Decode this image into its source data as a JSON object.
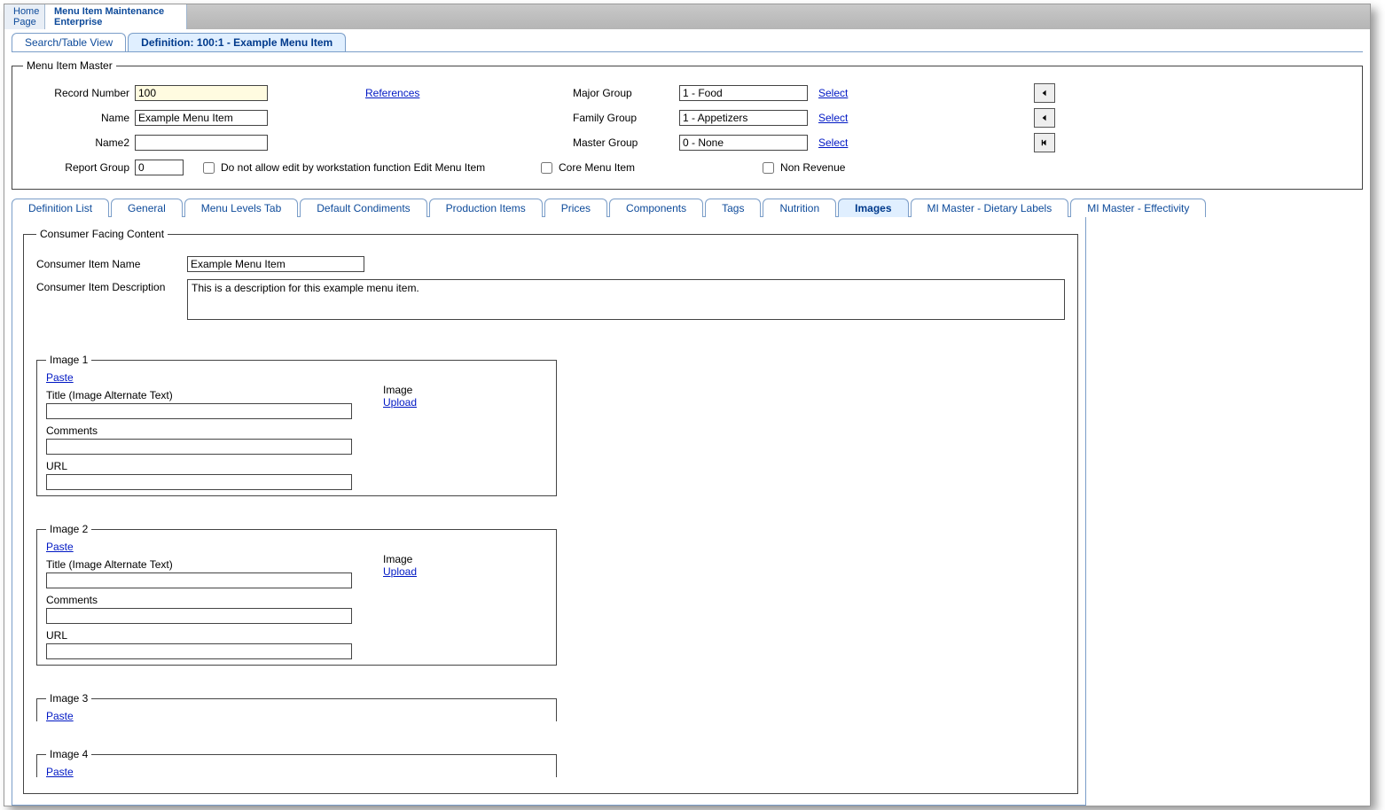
{
  "topTabs": {
    "home": "Home\nPage",
    "active": "Menu Item Maintenance\nEnterprise"
  },
  "viewTabs": {
    "search": "Search/Table View",
    "def": "Definition: 100:1 - Example Menu Item"
  },
  "master": {
    "legend": "Menu Item Master",
    "recordNumberLabel": "Record Number",
    "recordNumber": "100",
    "nameLabel": "Name",
    "name": "Example Menu Item",
    "name2Label": "Name2",
    "name2": "",
    "reportGroupLabel": "Report Group",
    "reportGroup": "0",
    "referencesLink": "References",
    "majorGroupLabel": "Major Group",
    "majorGroup": "1 - Food",
    "familyGroupLabel": "Family Group",
    "familyGroup": "1 - Appetizers",
    "masterGroupLabel": "Master Group",
    "masterGroup": "0 - None",
    "selectLink": "Select",
    "chk1": "Do not allow edit by workstation function Edit Menu Item",
    "chk2": "Core Menu Item",
    "chk3": "Non Revenue"
  },
  "subTabs": [
    "Definition List",
    "General",
    "Menu Levels Tab",
    "Default Condiments",
    "Production Items",
    "Prices",
    "Components",
    "Tags",
    "Nutrition",
    "Images",
    "MI Master - Dietary Labels",
    "MI Master - Effectivity"
  ],
  "subActive": 9,
  "consumer": {
    "legend": "Consumer Facing Content",
    "itemNameLabel": "Consumer Item Name",
    "itemName": "Example Menu Item",
    "descLabel": "Consumer Item Description",
    "desc": "This is a description for this example menu item.",
    "pasteLink": "Paste",
    "titleLabel": "Title (Image Alternate Text)",
    "commentsLabel": "Comments",
    "urlLabel": "URL",
    "imageWord": "Image",
    "uploadLink": "Upload",
    "slots": [
      "Image 1",
      "Image 2",
      "Image 3",
      "Image 4"
    ]
  }
}
